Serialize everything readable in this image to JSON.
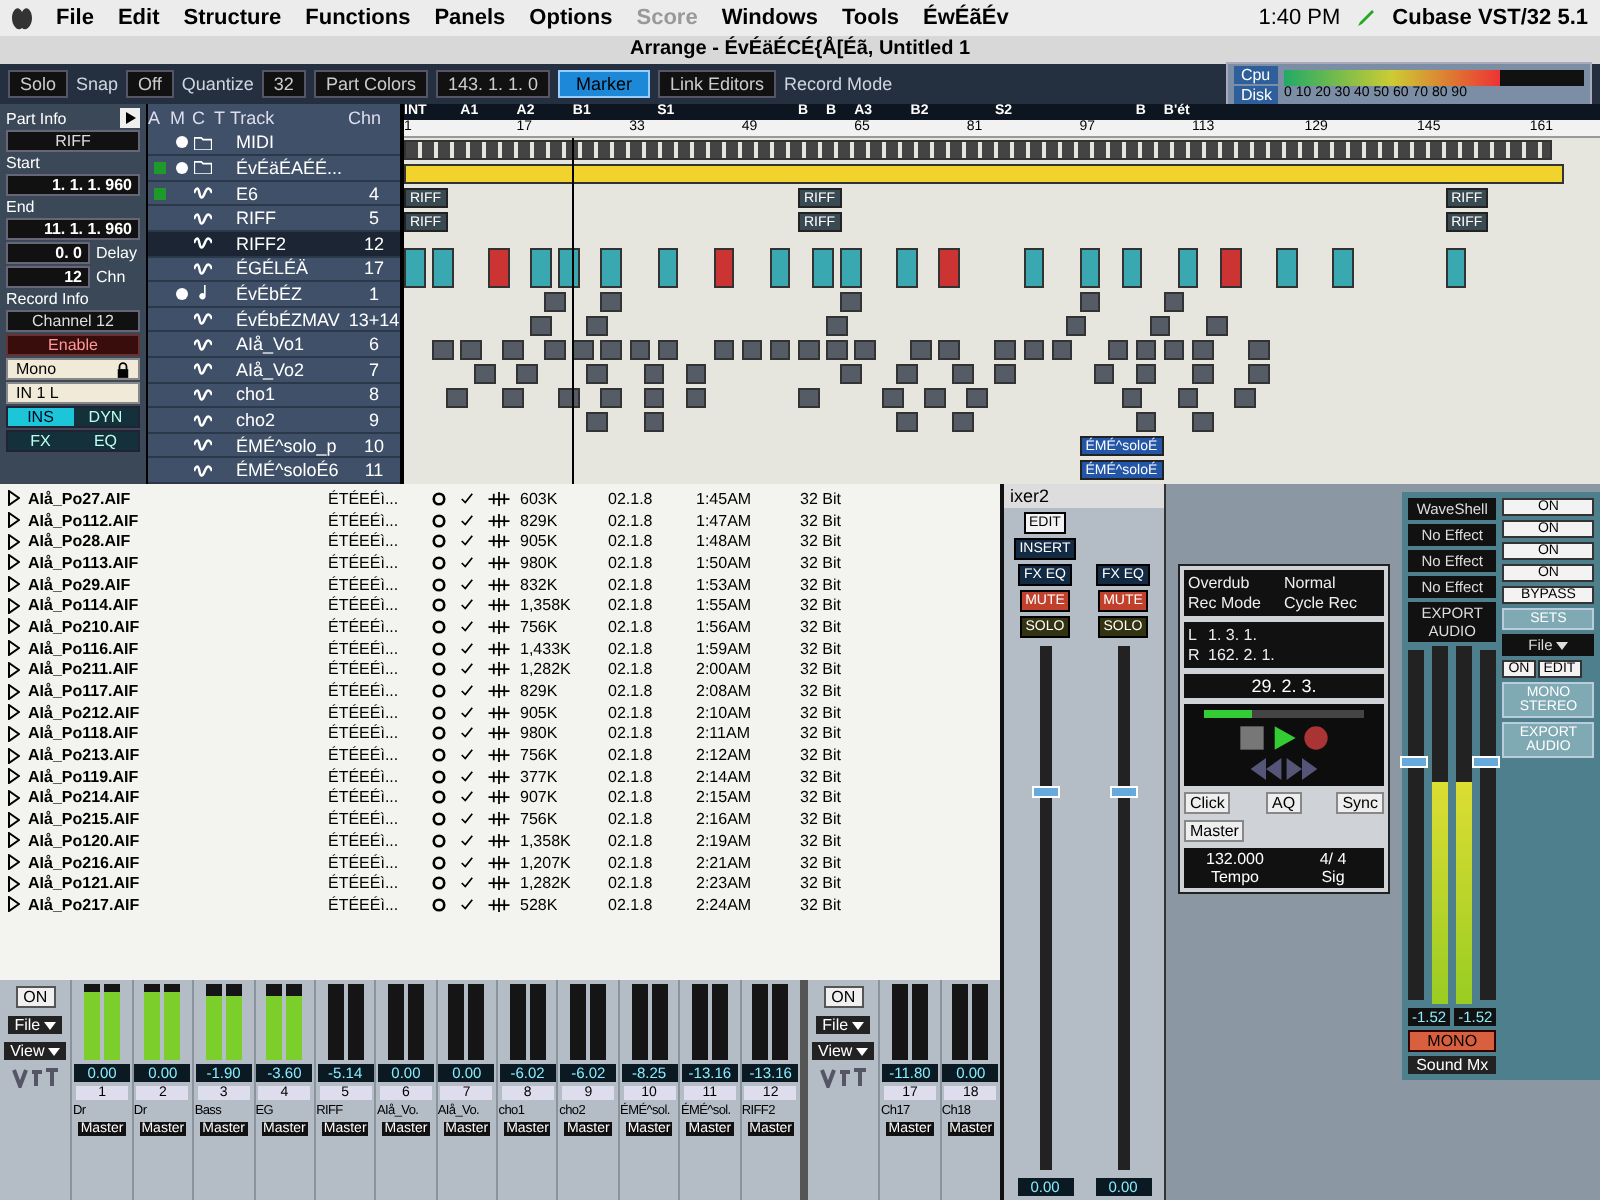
{
  "menubar": {
    "items": [
      {
        "label": "File",
        "disabled": false
      },
      {
        "label": "Edit",
        "disabled": false
      },
      {
        "label": "Structure",
        "disabled": false
      },
      {
        "label": "Functions",
        "disabled": false
      },
      {
        "label": "Panels",
        "disabled": false
      },
      {
        "label": "Options",
        "disabled": false
      },
      {
        "label": "Score",
        "disabled": true
      },
      {
        "label": "Windows",
        "disabled": false
      },
      {
        "label": "Tools",
        "disabled": false
      },
      {
        "label": "ÉwÉãÉv",
        "disabled": false
      }
    ],
    "time": "1:40 PM",
    "app": "Cubase VST/32 5.1"
  },
  "arrange": {
    "title": "Arrange - ÉvÉäÉCÉ{Å[Éã, Untitled 1",
    "toolbar": {
      "solo": "Solo",
      "snap_label": "Snap",
      "snap": "Off",
      "quantize_label": "Quantize",
      "quantize": "32",
      "part_colors": "Part Colors",
      "position": "143. 1. 1. 0",
      "marker": {
        "label": "Marker",
        "selected": true
      },
      "link_editors": "Link Editors",
      "record_mode": "Record Mode"
    },
    "performance": {
      "cpu_label": "Cpu",
      "disk_label": "Disk",
      "scale": "0 10 20 30 40 50 60 70 80 90",
      "level": 0.72
    },
    "inspector": {
      "title": "Part Info",
      "part": "RIFF",
      "start_label": "Start",
      "start": "1. 1. 1. 960",
      "end_label": "End",
      "end": "11. 1. 1. 960",
      "delay": "0. 0",
      "delay_label": "Delay",
      "chn": "12",
      "chn_label": "Chn",
      "record_info": "Record Info",
      "channel": "Channel 12",
      "enable": "Enable",
      "mono": "Mono",
      "input": "IN 1 L",
      "ins": {
        "label": "INS",
        "on": true
      },
      "dyn": {
        "label": "DYN",
        "on": false
      },
      "fx": {
        "label": "FX",
        "on": false
      },
      "eq": {
        "label": "EQ",
        "on": false
      }
    },
    "track_columns": [
      "A",
      "M",
      "C",
      "T",
      "Track",
      "Chn"
    ],
    "tracks": [
      {
        "name": "MIDI",
        "kind": "folder",
        "active": false,
        "muted": true,
        "selected": false
      },
      {
        "name": "ÉvÉäÉAÉÉ...",
        "kind": "folder",
        "active": true,
        "muted": true,
        "selected": false
      },
      {
        "name": "E6",
        "chn": "4",
        "kind": "audio",
        "active": true,
        "muted": false,
        "selected": false
      },
      {
        "name": "RIFF",
        "chn": "5",
        "kind": "audio",
        "active": false,
        "muted": false,
        "selected": false
      },
      {
        "name": "RIFF2",
        "chn": "12",
        "kind": "audio",
        "active": false,
        "muted": false,
        "selected": true
      },
      {
        "name": "ÉGÉLÉÄ",
        "chn": "17",
        "kind": "audio",
        "active": false,
        "muted": false,
        "selected": false
      },
      {
        "name": "ÉvÉbÉZ",
        "chn": "1",
        "kind": "midi",
        "active": false,
        "muted": true,
        "selected": false
      },
      {
        "name": "ÉvÉbÉZMAV",
        "chn": "13+14",
        "kind": "audio",
        "active": false,
        "muted": false,
        "selected": false
      },
      {
        "name": "AIå_Vo1",
        "chn": "6",
        "kind": "audio",
        "active": false,
        "muted": false,
        "selected": false
      },
      {
        "name": "AIå_Vo2",
        "chn": "7",
        "kind": "audio",
        "active": false,
        "muted": false,
        "selected": false
      },
      {
        "name": "cho1",
        "chn": "8",
        "kind": "audio",
        "active": false,
        "muted": false,
        "selected": false
      },
      {
        "name": "cho2",
        "chn": "9",
        "kind": "audio",
        "active": false,
        "muted": false,
        "selected": false
      },
      {
        "name": "ÉMÉ^solo_p",
        "chn": "10",
        "kind": "audio",
        "active": false,
        "muted": false,
        "selected": false
      },
      {
        "name": "ÉMÉ^soloÉ6",
        "chn": "11",
        "kind": "audio",
        "active": false,
        "muted": false,
        "selected": false
      }
    ],
    "markers": [
      "INT",
      "A1",
      "A2",
      "B1",
      "S1",
      "B",
      "B",
      "A3",
      "B2",
      "S2",
      "B",
      "B'ét"
    ],
    "ruler": [
      "1",
      "17",
      "33",
      "49",
      "65",
      "81",
      "97",
      "113",
      "129",
      "145",
      "161"
    ],
    "parts": [
      {
        "label": "RIFF",
        "kind": "audio"
      },
      {
        "label": "RIFF",
        "kind": "audio"
      },
      {
        "label": "RIFF",
        "kind": "audio"
      },
      {
        "label": "RIFF",
        "kind": "audio"
      },
      {
        "label": "RIFF",
        "kind": "audio"
      },
      {
        "label": "RIFF",
        "kind": "audio"
      },
      {
        "label": "ÉMÉ^soloÉ",
        "kind": "solo"
      },
      {
        "label": "ÉMÉ^soloÉ",
        "kind": "solo"
      }
    ]
  },
  "pool": {
    "files": [
      {
        "name": "AIå_Po27.AIF",
        "type": "ÉTÉEÉì...",
        "size": "603K",
        "date": "02.1.8",
        "time": "1:45AM",
        "res": "32 Bit"
      },
      {
        "name": "AIå_Po112.AIF",
        "type": "ÉTÉEÉì...",
        "size": "829K",
        "date": "02.1.8",
        "time": "1:47AM",
        "res": "32 Bit"
      },
      {
        "name": "AIå_Po28.AIF",
        "type": "ÉTÉEÉì...",
        "size": "905K",
        "date": "02.1.8",
        "time": "1:48AM",
        "res": "32 Bit"
      },
      {
        "name": "AIå_Po113.AIF",
        "type": "ÉTÉEÉì...",
        "size": "980K",
        "date": "02.1.8",
        "time": "1:50AM",
        "res": "32 Bit"
      },
      {
        "name": "AIå_Po29.AIF",
        "type": "ÉTÉEÉì...",
        "size": "832K",
        "date": "02.1.8",
        "time": "1:53AM",
        "res": "32 Bit"
      },
      {
        "name": "AIå_Po114.AIF",
        "type": "ÉTÉEÉì...",
        "size": "1,358K",
        "date": "02.1.8",
        "time": "1:55AM",
        "res": "32 Bit"
      },
      {
        "name": "AIå_Po210.AIF",
        "type": "ÉTÉEÉì...",
        "size": "756K",
        "date": "02.1.8",
        "time": "1:56AM",
        "res": "32 Bit"
      },
      {
        "name": "AIå_Po116.AIF",
        "type": "ÉTÉEÉì...",
        "size": "1,433K",
        "date": "02.1.8",
        "time": "1:59AM",
        "res": "32 Bit"
      },
      {
        "name": "AIå_Po211.AIF",
        "type": "ÉTÉEÉì...",
        "size": "1,282K",
        "date": "02.1.8",
        "time": "2:00AM",
        "res": "32 Bit"
      },
      {
        "name": "AIå_Po117.AIF",
        "type": "ÉTÉEÉì...",
        "size": "829K",
        "date": "02.1.8",
        "time": "2:08AM",
        "res": "32 Bit"
      },
      {
        "name": "AIå_Po212.AIF",
        "type": "ÉTÉEÉì...",
        "size": "905K",
        "date": "02.1.8",
        "time": "2:10AM",
        "res": "32 Bit"
      },
      {
        "name": "AIå_Po118.AIF",
        "type": "ÉTÉEÉì...",
        "size": "980K",
        "date": "02.1.8",
        "time": "2:11AM",
        "res": "32 Bit"
      },
      {
        "name": "AIå_Po213.AIF",
        "type": "ÉTÉEÉì...",
        "size": "756K",
        "date": "02.1.8",
        "time": "2:12AM",
        "res": "32 Bit"
      },
      {
        "name": "AIå_Po119.AIF",
        "type": "ÉTÉEÉì...",
        "size": "377K",
        "date": "02.1.8",
        "time": "2:14AM",
        "res": "32 Bit"
      },
      {
        "name": "AIå_Po214.AIF",
        "type": "ÉTÉEÉì...",
        "size": "907K",
        "date": "02.1.8",
        "time": "2:15AM",
        "res": "32 Bit"
      },
      {
        "name": "AIå_Po215.AIF",
        "type": "ÉTÉEÉì...",
        "size": "756K",
        "date": "02.1.8",
        "time": "2:16AM",
        "res": "32 Bit"
      },
      {
        "name": "AIå_Po120.AIF",
        "type": "ÉTÉEÉì...",
        "size": "1,358K",
        "date": "02.1.8",
        "time": "2:19AM",
        "res": "32 Bit"
      },
      {
        "name": "AIå_Po216.AIF",
        "type": "ÉTÉEÉì...",
        "size": "1,207K",
        "date": "02.1.8",
        "time": "2:21AM",
        "res": "32 Bit"
      },
      {
        "name": "AIå_Po121.AIF",
        "type": "ÉTÉEÉì...",
        "size": "1,282K",
        "date": "02.1.8",
        "time": "2:23AM",
        "res": "32 Bit"
      },
      {
        "name": "AIå_Po217.AIF",
        "type": "ÉTÉEÉì...",
        "size": "528K",
        "date": "02.1.8",
        "time": "2:24AM",
        "res": "32 Bit"
      }
    ]
  },
  "mixer": {
    "on": "ON",
    "file": "File",
    "view": "View",
    "channels": [
      {
        "num": "1",
        "name": "Dr",
        "value": "0.00",
        "level": 0.9,
        "output": "Master"
      },
      {
        "num": "2",
        "name": "Dr",
        "value": "0.00",
        "level": 0.9,
        "output": "Master"
      },
      {
        "num": "3",
        "name": "Bass",
        "value": "-1.90",
        "level": 0.85,
        "output": "Master"
      },
      {
        "num": "4",
        "name": "EG",
        "value": "-3.60",
        "level": 0.85,
        "output": "Master"
      },
      {
        "num": "5",
        "name": "RIFF",
        "value": "-5.14",
        "level": 0,
        "output": "Master"
      },
      {
        "num": "6",
        "name": "AIå_Vo.",
        "value": "0.00",
        "level": 0,
        "output": "Master"
      },
      {
        "num": "7",
        "name": "AIå_Vo.",
        "value": "0.00",
        "level": 0,
        "output": "Master"
      },
      {
        "num": "8",
        "name": "cho1",
        "value": "-6.02",
        "level": 0,
        "output": "Master"
      },
      {
        "num": "9",
        "name": "cho2",
        "value": "-6.02",
        "level": 0,
        "output": "Master"
      },
      {
        "num": "10",
        "name": "ÉMÉ^sol.",
        "value": "-8.25",
        "level": 0,
        "output": "Master"
      },
      {
        "num": "11",
        "name": "ÉMÉ^sol.",
        "value": "-13.16",
        "level": 0,
        "output": "Master"
      },
      {
        "num": "12",
        "name": "RIFF2",
        "value": "-13.16",
        "level": 0,
        "output": "Master"
      }
    ]
  },
  "mixer2": {
    "title": "ixer2",
    "on": "ON",
    "file": "File",
    "view": "View",
    "edit": "EDIT",
    "insert": "INSERT",
    "channels": [
      {
        "num": "17",
        "name": "Ch17",
        "value": "-11.80",
        "level": 0,
        "output": "Master"
      },
      {
        "num": "18",
        "name": "Ch18",
        "value": "0.00",
        "level": 0,
        "output": "Master"
      }
    ],
    "strips": [
      {
        "fx": "FX",
        "eq": "EQ",
        "mute": "MUTE",
        "solo": "SOLO",
        "value": "0.00",
        "level": 0.72
      },
      {
        "fx": "FX",
        "eq": "EQ",
        "mute": "MUTE",
        "solo": "SOLO",
        "value": "0.00",
        "level": 0.72
      }
    ]
  },
  "transport": {
    "mode": "Overdub",
    "cycle": "Normal",
    "mode_label": "Rec Mode",
    "cycle_label": "Cycle Rec",
    "left_label": "L",
    "left": "1. 3. 1.",
    "right_label": "R",
    "right": "162. 2. 1.",
    "position": "29. 2. 3.",
    "shuttle": {
      "level": 0.3
    },
    "click": "Click",
    "aq": "AQ",
    "sync": "Sync",
    "master": "Master",
    "tempo": "132.000",
    "sig": "4/ 4",
    "tempo_label": "Tempo",
    "sig_label": "Sig"
  },
  "master": {
    "inserts": [
      "WaveShell",
      "No Effect",
      "No Effect",
      "No Effect"
    ],
    "on": [
      "ON",
      "ON",
      "ON",
      "ON"
    ],
    "export": "EXPORT AUDIO",
    "bypass": "BYPASS",
    "sets": "SETS",
    "file": "File",
    "on_edit": [
      "ON",
      "EDIT"
    ],
    "mono_stereo": "MONO STEREO",
    "export2": "EXPORT AUDIO",
    "left_value": "-1.52",
    "right_value": "-1.52",
    "meter": {
      "level": 0.62
    },
    "fader": {
      "level": 0.68
    },
    "mono": "MONO",
    "output": "Sound Mx"
  }
}
